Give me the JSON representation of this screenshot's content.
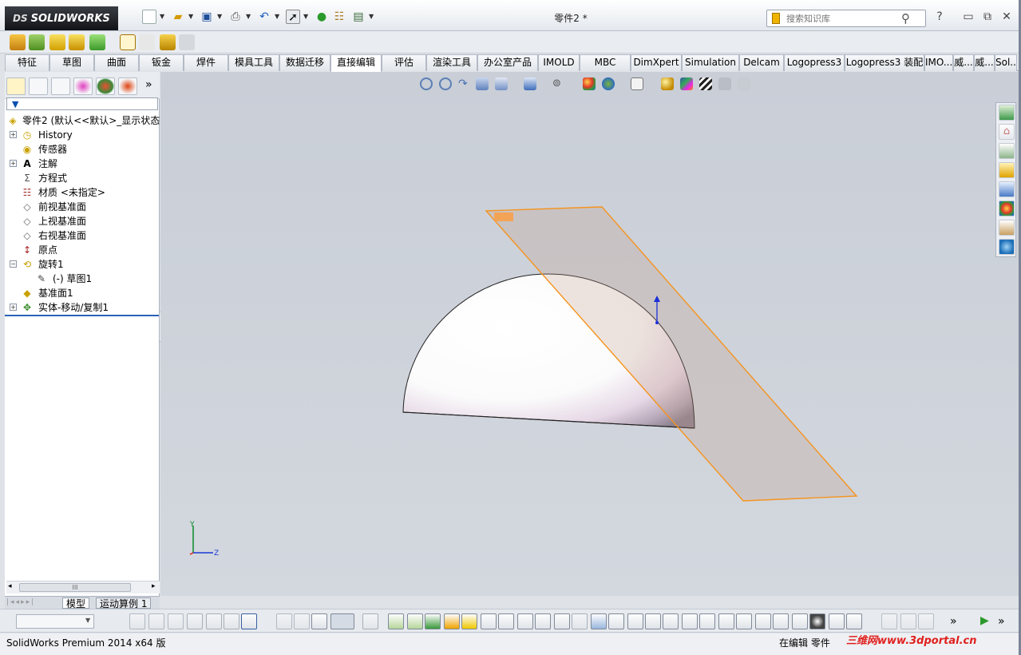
{
  "app": {
    "logo_prefix": "DS",
    "logo": "SOLIDWORKS",
    "document_title": "零件2 *",
    "search_placeholder": "搜索知识库",
    "help_icon": "?"
  },
  "tabs": [
    "特征",
    "草图",
    "曲面",
    "钣金",
    "焊件",
    "模具工具",
    "数据迁移",
    "直接编辑",
    "评估",
    "渲染工具",
    "办公室产品",
    "IMOLD",
    "MBC",
    "DimXpert",
    "Simulation",
    "Delcam",
    "Logopress3",
    "Logopress3 装配",
    "IMO...",
    "威...",
    "威...",
    "Sol..."
  ],
  "active_tab": "直接编辑",
  "feature_tree": {
    "root": "零件2  (默认<<默认>_显示状态",
    "items": [
      {
        "label": "History",
        "icon": "history-icon"
      },
      {
        "label": "传感器",
        "icon": "sensor-icon"
      },
      {
        "label": "注解",
        "icon": "annotation-icon"
      },
      {
        "label": "方程式",
        "icon": "equation-icon"
      },
      {
        "label": "材质 <未指定>",
        "icon": "material-icon"
      },
      {
        "label": "前视基准面",
        "icon": "plane-icon"
      },
      {
        "label": "上视基准面",
        "icon": "plane-icon"
      },
      {
        "label": "右视基准面",
        "icon": "plane-icon"
      },
      {
        "label": "原点",
        "icon": "origin-icon"
      },
      {
        "label": "旋转1",
        "icon": "revolve-icon"
      },
      {
        "label": "(-) 草图1",
        "icon": "sketch-icon"
      },
      {
        "label": "基准面1",
        "icon": "plane-icon"
      },
      {
        "label": "实体-移动/复制1",
        "icon": "move-copy-icon"
      }
    ]
  },
  "bottom_tabs": [
    "模型",
    "运动算例 1"
  ],
  "statusbar": {
    "left": "SolidWorks Premium 2014 x64 版",
    "right": "在编辑 零件",
    "watermark": "三维网www.3dportal.cn"
  },
  "triad": {
    "y": "Y",
    "z": "Z"
  },
  "colors": {
    "plane_edge": "#f5941d",
    "accent": "#2b62b6"
  }
}
